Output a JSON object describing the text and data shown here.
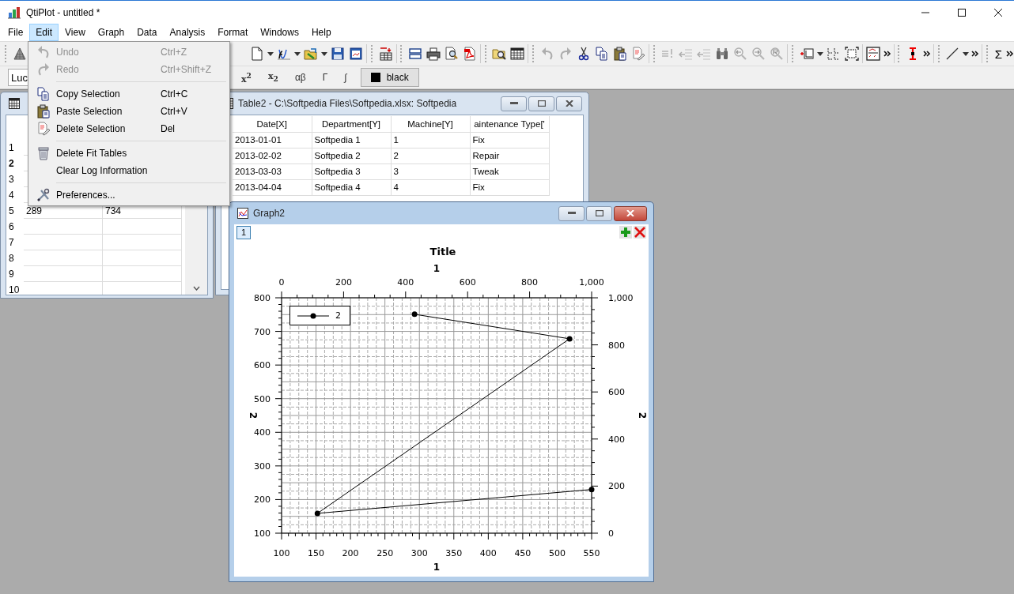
{
  "window": {
    "title": "QtiPlot - untitled *"
  },
  "menu_bar": [
    {
      "label": "File",
      "selected": false
    },
    {
      "label": "Edit",
      "selected": true
    },
    {
      "label": "View",
      "selected": false
    },
    {
      "label": "Graph",
      "selected": false
    },
    {
      "label": "Data",
      "selected": false
    },
    {
      "label": "Analysis",
      "selected": false
    },
    {
      "label": "Format",
      "selected": false
    },
    {
      "label": "Windows",
      "selected": false
    },
    {
      "label": "Help",
      "selected": false
    }
  ],
  "edit_menu": [
    {
      "kind": "item",
      "label": "Undo",
      "shortcut": "Ctrl+Z",
      "disabled": true
    },
    {
      "kind": "item",
      "label": "Redo",
      "shortcut": "Ctrl+Shift+Z",
      "disabled": true
    },
    {
      "kind": "separator"
    },
    {
      "kind": "item",
      "label": "Copy Selection",
      "shortcut": "Ctrl+C",
      "disabled": false
    },
    {
      "kind": "item",
      "label": "Paste Selection",
      "shortcut": "Ctrl+V",
      "disabled": false
    },
    {
      "kind": "item",
      "label": "Delete Selection",
      "shortcut": "Del",
      "disabled": false
    },
    {
      "kind": "separator"
    },
    {
      "kind": "item",
      "label": "Delete Fit Tables",
      "disabled": false
    },
    {
      "kind": "item",
      "label": "Clear Log Information",
      "disabled": false
    },
    {
      "kind": "separator"
    },
    {
      "kind": "item",
      "label": "Preferences...",
      "disabled": false
    }
  ],
  "main_toolbar": {
    "sum_button": "Σ"
  },
  "format_toolbar": {
    "font_field": {
      "value": "Luc"
    },
    "buttons": [
      "x$^{2}$",
      "x$_{2}$",
      "αβ",
      "Γ",
      "∫"
    ],
    "color_button": {
      "label": "black",
      "color": "#000000"
    }
  },
  "table1": {
    "rows": [
      {
        "number": "1",
        "selected": false
      },
      {
        "number": "2",
        "selected": true
      },
      {
        "number": "3",
        "selected": false
      },
      {
        "number": "4",
        "selected": false
      },
      {
        "number": "5",
        "selected": false,
        "cells": [
          "289",
          "734"
        ]
      },
      {
        "number": "6",
        "selected": false
      },
      {
        "number": "7",
        "selected": false
      },
      {
        "number": "8",
        "selected": false
      },
      {
        "number": "9",
        "selected": false
      },
      {
        "number": "10",
        "selected": false
      }
    ]
  },
  "table2": {
    "title": "Table2 - C:\\Softpedia Files\\Softpedia.xlsx: Softpedia",
    "columns": [
      "Date[X]",
      "Department[Y]",
      "Machine[Y]",
      "aintenance Type['"
    ],
    "rows": [
      [
        "2013-01-01",
        "Softpedia 1",
        "1",
        "Fix"
      ],
      [
        "2013-02-02",
        "Softpedia 2",
        "2",
        "Repair"
      ],
      [
        "2013-03-03",
        "Softpedia 3",
        "3",
        "Tweak"
      ],
      [
        "2013-04-04",
        "Softpedia 4",
        "4",
        "Fix"
      ]
    ]
  },
  "graph_window": {
    "title": "Graph2",
    "layer_button": {
      "label": "1",
      "selected": true
    },
    "top_axis": {
      "title": "1",
      "ticks": [
        "0",
        "200",
        "400",
        "600",
        "800",
        "1,000"
      ]
    },
    "right_axis": {
      "title": "2",
      "ticks": [
        "1,000",
        "800",
        "600",
        "400",
        "200",
        "0"
      ]
    },
    "chart_data": {
      "type": "line",
      "title": "Title",
      "xlabel": "1",
      "ylabel": "2",
      "grid": true,
      "x": [
        293,
        518,
        152,
        550
      ],
      "series": [
        {
          "name": "2",
          "color": "#000000",
          "marker": "circle",
          "values": [
            751,
            678,
            159,
            230
          ]
        }
      ],
      "xlim": [
        100,
        550
      ],
      "ylim": [
        100,
        800
      ],
      "xticks": [
        100,
        150,
        200,
        250,
        300,
        350,
        400,
        450,
        500,
        550
      ],
      "yticks": [
        100,
        200,
        300,
        400,
        500,
        600,
        700,
        800
      ]
    }
  }
}
